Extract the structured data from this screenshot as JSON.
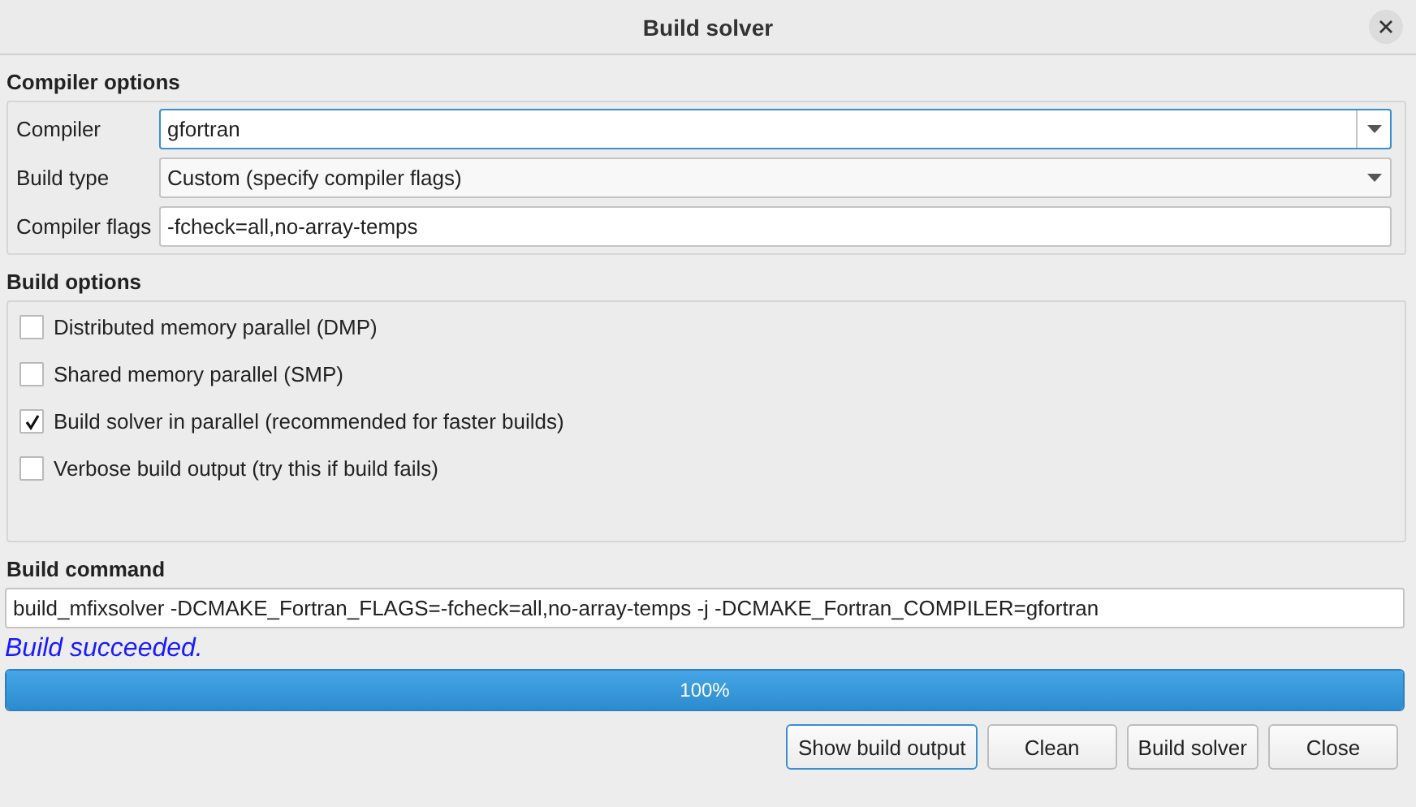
{
  "window": {
    "title": "Build solver"
  },
  "compiler_options": {
    "title": "Compiler options",
    "fields": [
      {
        "label": "Compiler",
        "kind": "editable-combo",
        "value": "gfortran",
        "focused": true
      },
      {
        "label": "Build type",
        "kind": "combo",
        "value": "Custom (specify compiler flags)",
        "focused": false
      },
      {
        "label": "Compiler flags",
        "kind": "text",
        "value": "-fcheck=all,no-array-temps",
        "focused": false
      }
    ]
  },
  "build_options": {
    "title": "Build options",
    "items": [
      {
        "label": "Distributed memory parallel (DMP)",
        "checked": false
      },
      {
        "label": "Shared memory parallel (SMP)",
        "checked": false
      },
      {
        "label": "Build solver in parallel (recommended for faster builds)",
        "checked": true
      },
      {
        "label": "Verbose build output (try this if build fails)",
        "checked": false
      }
    ]
  },
  "build_command": {
    "title": "Build command",
    "value": "build_mfixsolver -DCMAKE_Fortran_FLAGS=-fcheck=all,no-array-temps -j -DCMAKE_Fortran_COMPILER=gfortran"
  },
  "status": "Build succeeded.",
  "progress": {
    "level": 1,
    "reading": "100%"
  },
  "buttons": [
    {
      "label": "Show build output",
      "focused": true
    },
    {
      "label": "Clean",
      "focused": false
    },
    {
      "label": "Build solver",
      "focused": false
    },
    {
      "label": "Close",
      "focused": false
    }
  ]
}
